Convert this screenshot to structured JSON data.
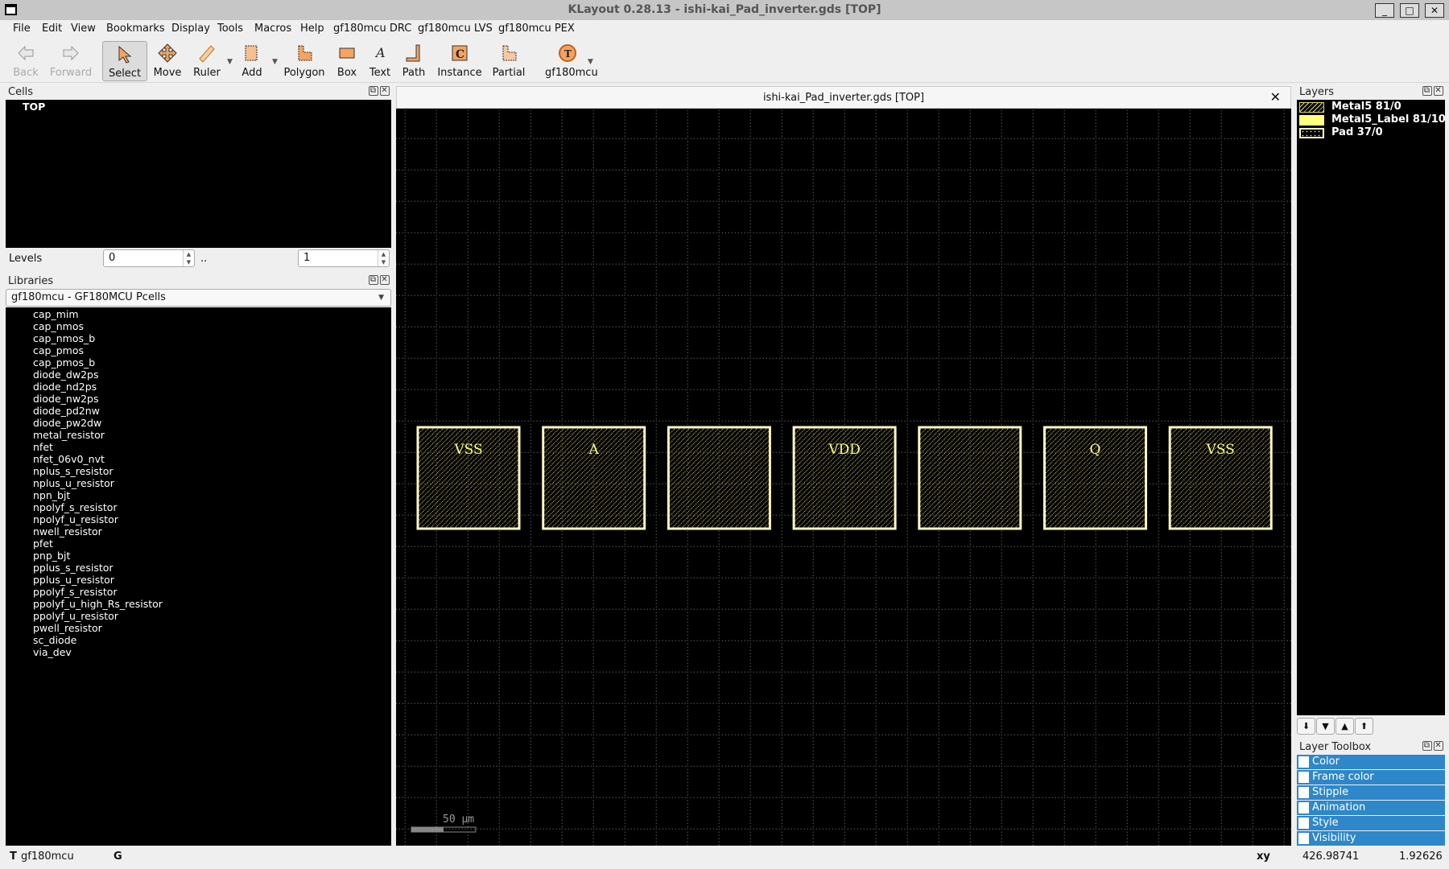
{
  "window": {
    "title": "KLayout 0.28.13 - ishi-kai_Pad_inverter.gds [TOP]",
    "controls": [
      "minimize",
      "maximize",
      "close"
    ]
  },
  "menu": [
    "File",
    "Edit",
    "View",
    "Bookmarks",
    "Display",
    "Tools",
    "Macros",
    "Help",
    "gf180mcu DRC",
    "gf180mcu LVS",
    "gf180mcu PEX"
  ],
  "toolbar": [
    {
      "label": "Back",
      "icon": "arrow-left-icon",
      "disabled": true
    },
    {
      "label": "Forward",
      "icon": "arrow-right-icon",
      "disabled": true
    },
    {
      "label": "Select",
      "icon": "cursor-icon",
      "selected": true
    },
    {
      "label": "Move",
      "icon": "move-icon"
    },
    {
      "label": "Ruler",
      "icon": "ruler-icon",
      "dropdown": true
    },
    {
      "label": "Add",
      "icon": "add-icon",
      "dropdown": true
    },
    {
      "label": "Polygon",
      "icon": "polygon-icon"
    },
    {
      "label": "Box",
      "icon": "box-icon"
    },
    {
      "label": "Text",
      "icon": "text-icon"
    },
    {
      "label": "Path",
      "icon": "path-icon"
    },
    {
      "label": "Instance",
      "icon": "instance-icon"
    },
    {
      "label": "Partial",
      "icon": "partial-icon"
    },
    {
      "label": "gf180mcu",
      "icon": "tech-icon",
      "dropdown": true
    }
  ],
  "cells": {
    "title": "Cells",
    "items": [
      "TOP"
    ],
    "levels_label": "Levels",
    "level_from": "0",
    "level_sep": "..",
    "level_to": "1"
  },
  "libraries": {
    "title": "Libraries",
    "selected": "gf180mcu - GF180MCU Pcells",
    "items": [
      "cap_mim",
      "cap_nmos",
      "cap_nmos_b",
      "cap_pmos",
      "cap_pmos_b",
      "diode_dw2ps",
      "diode_nd2ps",
      "diode_nw2ps",
      "diode_pd2nw",
      "diode_pw2dw",
      "metal_resistor",
      "nfet",
      "nfet_06v0_nvt",
      "nplus_s_resistor",
      "nplus_u_resistor",
      "npn_bjt",
      "npolyf_s_resistor",
      "npolyf_u_resistor",
      "nwell_resistor",
      "pfet",
      "pnp_bjt",
      "pplus_s_resistor",
      "pplus_u_resistor",
      "ppolyf_s_resistor",
      "ppolyf_u_high_Rs_resistor",
      "ppolyf_u_resistor",
      "pwell_resistor",
      "sc_diode",
      "via_dev"
    ]
  },
  "view": {
    "tab_title": "ishi-kai_Pad_inverter.gds [TOP]",
    "pads": [
      "VSS",
      "A",
      "",
      "VDD",
      "",
      "Q",
      "VSS"
    ],
    "scale_bar": "50 µm",
    "colors": {
      "background": "#000000",
      "pad_frame": "#fff8c4",
      "hatch": "#e0d870",
      "label": "#ffff80",
      "grid": "#8a8a8a"
    }
  },
  "layers": {
    "title": "Layers",
    "items": [
      {
        "name": "Metal5 81/0",
        "style": "hatched",
        "color": "#e0d870"
      },
      {
        "name": "Metal5_Label 81/10",
        "style": "solid",
        "color": "#ffff80"
      },
      {
        "name": "Pad 37/0",
        "style": "dotted",
        "color": "#fff8c4"
      }
    ],
    "buttons": [
      "move-to-bottom",
      "move-down",
      "move-up",
      "move-to-top"
    ]
  },
  "layer_toolbox": {
    "title": "Layer Toolbox",
    "items": [
      "Color",
      "Frame color",
      "Stipple",
      "Animation",
      "Style",
      "Visibility"
    ],
    "accent": "#2e87c8"
  },
  "status": {
    "mode": "T",
    "tech": "gf180mcu",
    "grid": "G",
    "coord_label": "xy",
    "x": "426.98741",
    "y": "1.92626"
  }
}
